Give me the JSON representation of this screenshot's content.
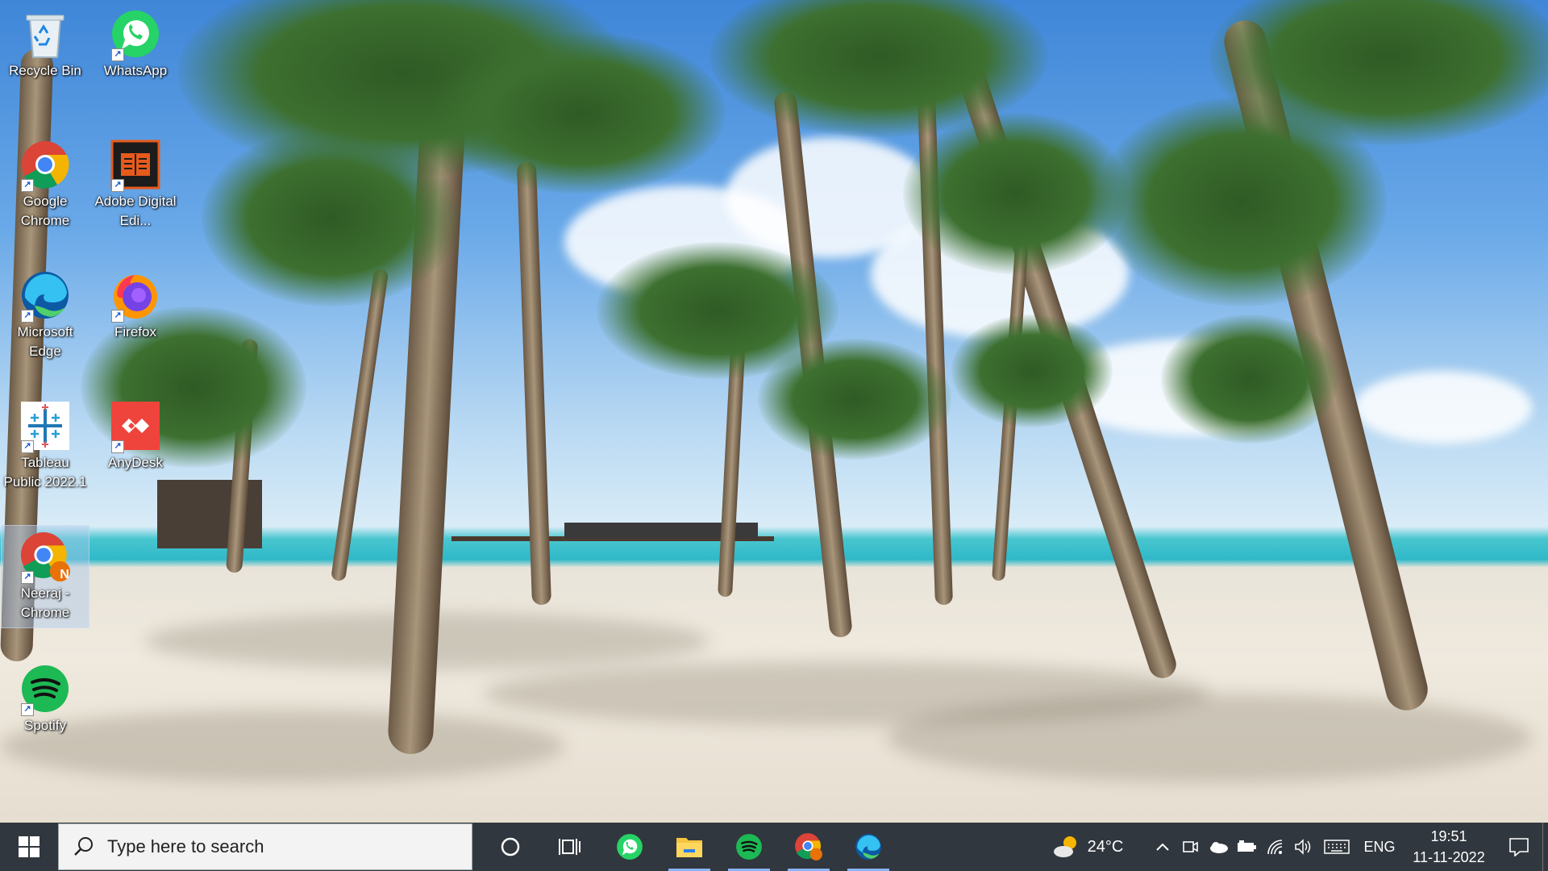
{
  "desktop": {
    "icons": [
      {
        "label": "Recycle Bin",
        "icon": "recycle-bin-icon"
      },
      {
        "label": "WhatsApp",
        "icon": "whatsapp-icon"
      },
      {
        "label": "Google Chrome",
        "icon": "chrome-icon"
      },
      {
        "label": "Adobe Digital Edi...",
        "icon": "adobe-digital-editions-icon"
      },
      {
        "label": "Microsoft Edge",
        "icon": "edge-icon"
      },
      {
        "label": "Firefox",
        "icon": "firefox-icon"
      },
      {
        "label": "Tableau Public 2022.1",
        "icon": "tableau-icon"
      },
      {
        "label": "AnyDesk",
        "icon": "anydesk-icon"
      },
      {
        "label": "Neeraj - Chrome",
        "icon": "chrome-profile-icon",
        "badge": "N"
      },
      {
        "label": "Spotify",
        "icon": "spotify-icon"
      }
    ]
  },
  "taskbar": {
    "search_placeholder": "Type here to search",
    "pinned": [
      "whatsapp-icon",
      "file-explorer-icon",
      "spotify-icon",
      "chrome-profile-icon",
      "edge-icon"
    ],
    "weather": {
      "temperature": "24°C",
      "icon": "partly-cloudy-icon"
    },
    "language": "ENG",
    "time": "19:51",
    "date": "11-11-2022"
  },
  "colors": {
    "taskbar": "#20262e",
    "accent": "#8ab4ff",
    "spotify": "#1db954",
    "anydesk": "#ef443b",
    "whatsapp": "#25d366"
  }
}
